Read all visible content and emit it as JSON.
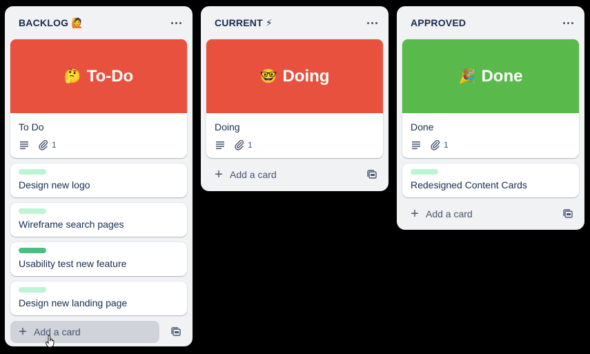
{
  "colors": {
    "background": "#000000",
    "list_bg": "#f1f2f4",
    "cover_red": "#e9513f",
    "cover_green": "#59b94a",
    "label_light_green": "#bcf4d6",
    "label_green": "#4bbe86"
  },
  "lists": [
    {
      "title": "BACKLOG 🙋",
      "cover_card": {
        "cover_emoji": "🤔",
        "cover_text": "To-Do",
        "title": "To Do",
        "description_icon": "description-icon",
        "attachment_icon": "paperclip-icon",
        "attachment_count": "1"
      },
      "cards": [
        {
          "title": "Design new logo",
          "label_color": "#bcf4d6"
        },
        {
          "title": "Wireframe search pages",
          "label_color": "#bcf4d6"
        },
        {
          "title": "Usability test new feature",
          "label_color": "#4bbe86"
        },
        {
          "title": "Design new landing page",
          "label_color": "#bcf4d6"
        }
      ],
      "add_card_label": "Add a card",
      "menu_icon": "more-icon",
      "template_icon": "card-template-icon"
    },
    {
      "title": "CURRENT ⚡",
      "cover_card": {
        "cover_emoji": "🤓",
        "cover_text": "Doing",
        "title": "Doing",
        "description_icon": "description-icon",
        "attachment_icon": "paperclip-icon",
        "attachment_count": "1"
      },
      "cards": [],
      "add_card_label": "Add a card",
      "menu_icon": "more-icon",
      "template_icon": "card-template-icon"
    },
    {
      "title": "APPROVED",
      "cover_card": {
        "cover_emoji": "🎉",
        "cover_text": "Done",
        "title": "Done",
        "description_icon": "description-icon",
        "attachment_icon": "paperclip-icon",
        "attachment_count": "1"
      },
      "cards": [
        {
          "title": "Redesigned Content Cards",
          "label_color": "#bcf4d6"
        }
      ],
      "add_card_label": "Add a card",
      "menu_icon": "more-icon",
      "template_icon": "card-template-icon"
    }
  ]
}
